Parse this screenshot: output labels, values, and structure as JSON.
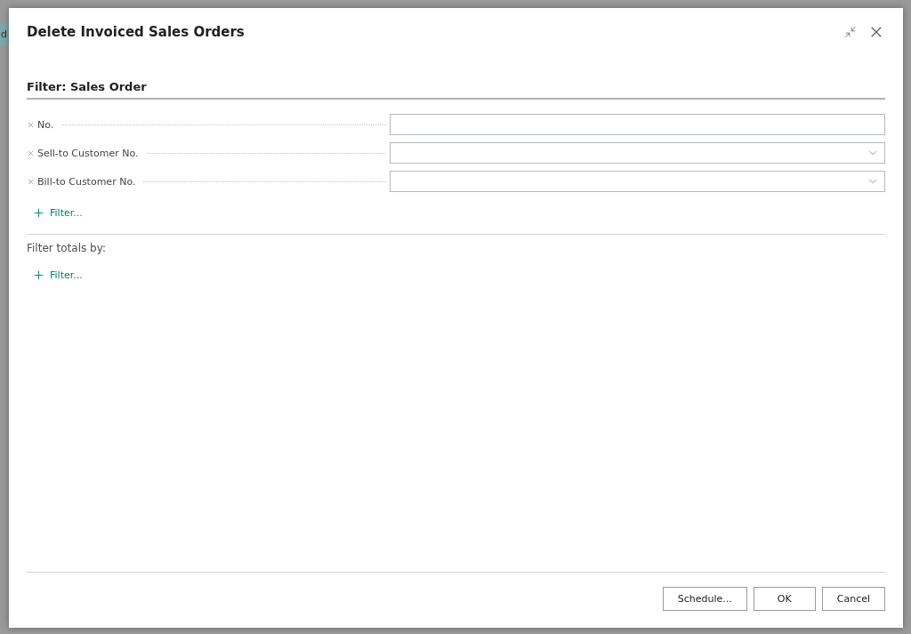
{
  "background": {
    "tab_fragment": "d"
  },
  "dialog": {
    "title": "Delete Invoiced Sales Orders"
  },
  "filter_section": {
    "heading": "Filter: Sales Order",
    "fields": [
      {
        "label": "No.",
        "kind": "text"
      },
      {
        "label": "Sell-to Customer No.",
        "kind": "dropdown"
      },
      {
        "label": "Bill-to Customer No.",
        "kind": "dropdown"
      }
    ],
    "add_filter": "Filter..."
  },
  "totals_section": {
    "heading": "Filter totals by:",
    "add_filter": "Filter..."
  },
  "buttons": [
    "Schedule...",
    "OK",
    "Cancel"
  ]
}
